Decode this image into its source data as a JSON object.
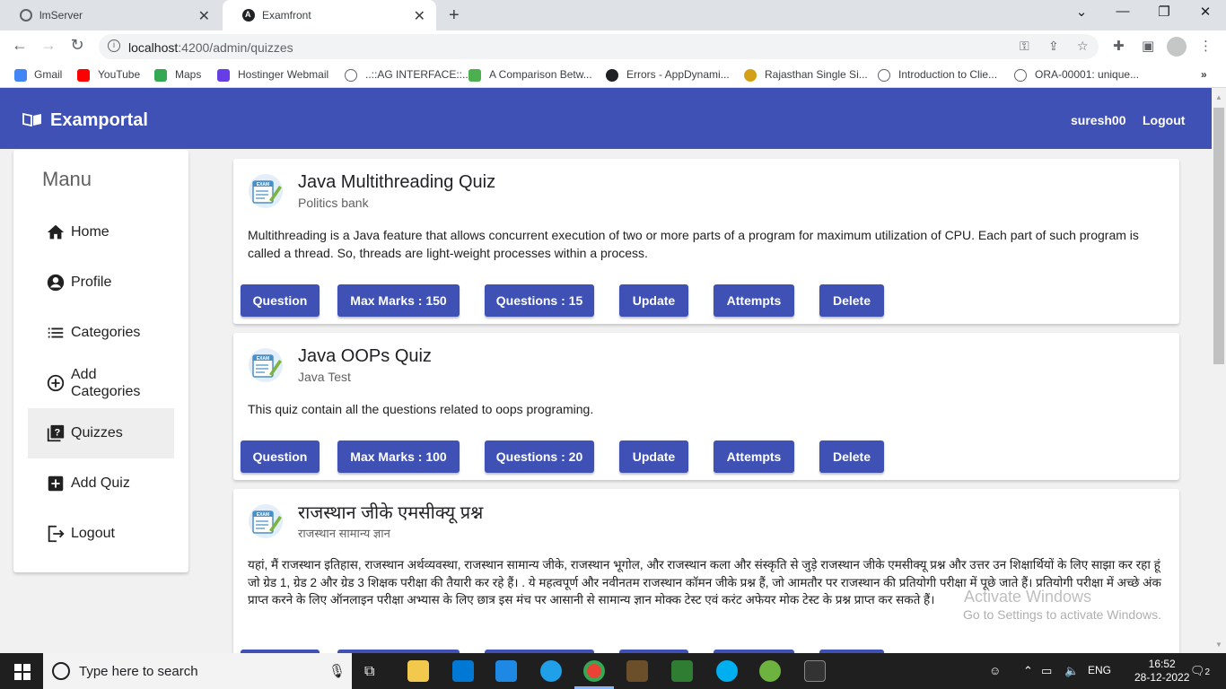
{
  "browser": {
    "tabs": [
      {
        "title": "lmServer",
        "icon": "globe-icon"
      },
      {
        "title": "Examfront",
        "icon": "angular-icon"
      }
    ],
    "url_host": "localhost",
    "url_rest": ":4200/admin/quizzes",
    "bookmarks": [
      {
        "label": "Gmail",
        "icon": "google-icon",
        "color": "#4285f4"
      },
      {
        "label": "YouTube",
        "icon": "youtube-icon",
        "color": "#ff0000"
      },
      {
        "label": "Maps",
        "icon": "maps-icon",
        "color": "#34a853"
      },
      {
        "label": "Hostinger Webmail",
        "icon": "hostinger-icon",
        "color": "#673de6"
      },
      {
        "label": "..::AG INTERFACE::..",
        "icon": "globe-icon",
        "color": "#5f6368"
      },
      {
        "label": "A Comparison Betw...",
        "icon": "leaf-icon",
        "color": "#4caf50"
      },
      {
        "label": "Errors - AppDynami...",
        "icon": "appdynamics-icon",
        "color": "#202124"
      },
      {
        "label": "Rajasthan Single Si...",
        "icon": "emblem-icon",
        "color": "#d4a017"
      },
      {
        "label": "Introduction to Clie...",
        "icon": "globe-icon",
        "color": "#5f6368"
      },
      {
        "label": "ORA-00001: unique...",
        "icon": "oracle-icon",
        "color": "#5f6368"
      }
    ]
  },
  "app": {
    "brand": "Examportal",
    "username": "suresh00",
    "logout": "Logout",
    "accent": "#3f51b5"
  },
  "sidebar": {
    "title": "Manu",
    "items": [
      {
        "label": "Home",
        "icon": "home-icon"
      },
      {
        "label": "Profile",
        "icon": "account-icon"
      },
      {
        "label": "Categories",
        "icon": "list-icon"
      },
      {
        "label": "Add Categories",
        "icon": "add-circle-icon"
      },
      {
        "label": "Quizzes",
        "icon": "quiz-icon",
        "active": true
      },
      {
        "label": "Add Quiz",
        "icon": "add-box-icon"
      },
      {
        "label": "Logout",
        "icon": "logout-icon"
      }
    ]
  },
  "quizzes": [
    {
      "title": "Java Multithreading Quiz",
      "category": "Politics bank",
      "description": "Multithreading is a Java feature that allows concurrent execution of two or more parts of a program for maximum utilization of CPU. Each part of such program is called a thread. So, threads are light-weight processes within a process.",
      "buttons": {
        "question": "Question",
        "max_marks": "Max Marks : 150",
        "questions": "Questions : 15",
        "update": "Update",
        "attempts": "Attempts",
        "delete": "Delete"
      }
    },
    {
      "title": "Java OOPs Quiz",
      "category": "Java Test",
      "description": "This quiz contain all the questions related to oops programing.",
      "buttons": {
        "question": "Question",
        "max_marks": "Max Marks : 100",
        "questions": "Questions : 20",
        "update": "Update",
        "attempts": "Attempts",
        "delete": "Delete"
      }
    },
    {
      "title": "राजस्थान जीके एमसीक्यू प्रश्न",
      "category": "राजस्थान सामान्य ज्ञान",
      "description": "यहां, मैं राजस्थान इतिहास, राजस्थान अर्थव्यवस्था, राजस्थान सामान्य जीके, राजस्थान भूगोल, और राजस्थान कला और संस्कृति से जुड़े राजस्थान जीके एमसीक्यू प्रश्न और उत्तर उन शिक्षार्थियों के लिए साझा कर रहा हूं जो ग्रेड 1, ग्रेड 2 और ग्रेड 3 शिक्षक परीक्षा की तैयारी कर रहे हैं। . ये महत्वपूर्ण और नवीनतम राजस्थान कॉमन जीके प्रश्न हैं, जो आमतौर पर राजस्थान की प्रतियोगी परीक्षा में पूछे जाते हैं। प्रतियोगी परीक्षा में अच्छे अंक प्राप्त करने के लिए ऑनलाइन परीक्षा अभ्यास के लिए छात्र इस मंच पर आसानी से सामान्य ज्ञान मोक्क टेस्ट एवं करंट अफेयर मोक टेस्ट के प्रश्न प्राप्त कर सकते हैं।"
    }
  ],
  "watermark": {
    "line1": "Activate Windows",
    "line2": "Go to Settings to activate Windows."
  },
  "taskbar": {
    "search_placeholder": "Type here to search",
    "language": "ENG",
    "time": "16:52",
    "date": "28-12-2022",
    "notification_count": "2"
  }
}
